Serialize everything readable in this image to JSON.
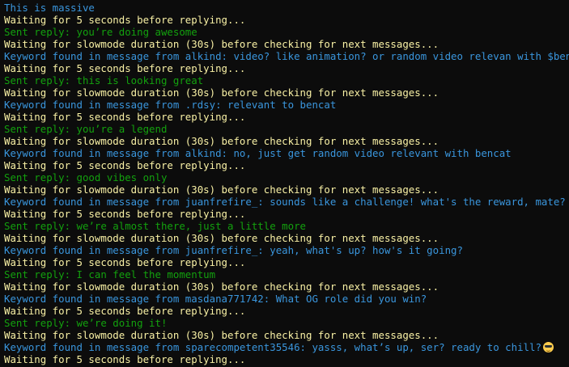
{
  "terminal": {
    "colors": {
      "background": "#0c0c0c",
      "info": "#3a96dd",
      "waiting": "#f9f1a5",
      "sent": "#13a10e"
    },
    "lines": [
      {
        "text": "This is massive",
        "kind": "info"
      },
      {
        "text": "Waiting for 5 seconds before replying...",
        "kind": "waiting"
      },
      {
        "text": "Sent reply: you’re doing awesome",
        "kind": "sent"
      },
      {
        "text": "Waiting for slowmode duration (30s) before checking for next messages...",
        "kind": "waiting"
      },
      {
        "text": "Keyword found in message from alkind: video? like animation? or random video relevan with $bencat",
        "kind": "info"
      },
      {
        "text": "Waiting for 5 seconds before replying...",
        "kind": "waiting"
      },
      {
        "text": "Sent reply: this is looking great",
        "kind": "sent"
      },
      {
        "text": "Waiting for slowmode duration (30s) before checking for next messages...",
        "kind": "waiting"
      },
      {
        "text": "Keyword found in message from .rdsy: relevant to bencat",
        "kind": "info"
      },
      {
        "text": "Waiting for 5 seconds before replying...",
        "kind": "waiting"
      },
      {
        "text": "Sent reply: you’re a legend",
        "kind": "sent"
      },
      {
        "text": "Waiting for slowmode duration (30s) before checking for next messages...",
        "kind": "waiting"
      },
      {
        "text": "Keyword found in message from alkind: no, just get random video relevant with bencat",
        "kind": "info"
      },
      {
        "text": "Waiting for 5 seconds before replying...",
        "kind": "waiting"
      },
      {
        "text": "Sent reply: good vibes only",
        "kind": "sent"
      },
      {
        "text": "Waiting for slowmode duration (30s) before checking for next messages...",
        "kind": "waiting"
      },
      {
        "text": "Keyword found in message from juanfrefire_: sounds like a challenge! what's the reward, mate?",
        "kind": "info"
      },
      {
        "text": "Waiting for 5 seconds before replying...",
        "kind": "waiting"
      },
      {
        "text": "Sent reply: we’re almost there, just a little more",
        "kind": "sent"
      },
      {
        "text": "Waiting for slowmode duration (30s) before checking for next messages...",
        "kind": "waiting"
      },
      {
        "text": "Keyword found in message from juanfrefire_: yeah, what's up? how's it going?",
        "kind": "info"
      },
      {
        "text": "Waiting for 5 seconds before replying...",
        "kind": "waiting"
      },
      {
        "text": "Sent reply: I can feel the momentum",
        "kind": "sent"
      },
      {
        "text": "Waiting for slowmode duration (30s) before checking for next messages...",
        "kind": "waiting"
      },
      {
        "text": "Keyword found in message from masdana771742: What OG role did you win?",
        "kind": "info"
      },
      {
        "text": "Waiting for 5 seconds before replying...",
        "kind": "waiting"
      },
      {
        "text": "Sent reply: we’re doing it!",
        "kind": "sent"
      },
      {
        "text": "Waiting for slowmode duration (30s) before checking for next messages...",
        "kind": "waiting"
      },
      {
        "text": "Keyword found in message from sparecompetent35546: yasss, what’s up, ser? ready to chill?",
        "kind": "info",
        "icon": "sunglasses-emoji-icon"
      },
      {
        "text": "Waiting for 5 seconds before replying...",
        "kind": "waiting"
      }
    ]
  }
}
